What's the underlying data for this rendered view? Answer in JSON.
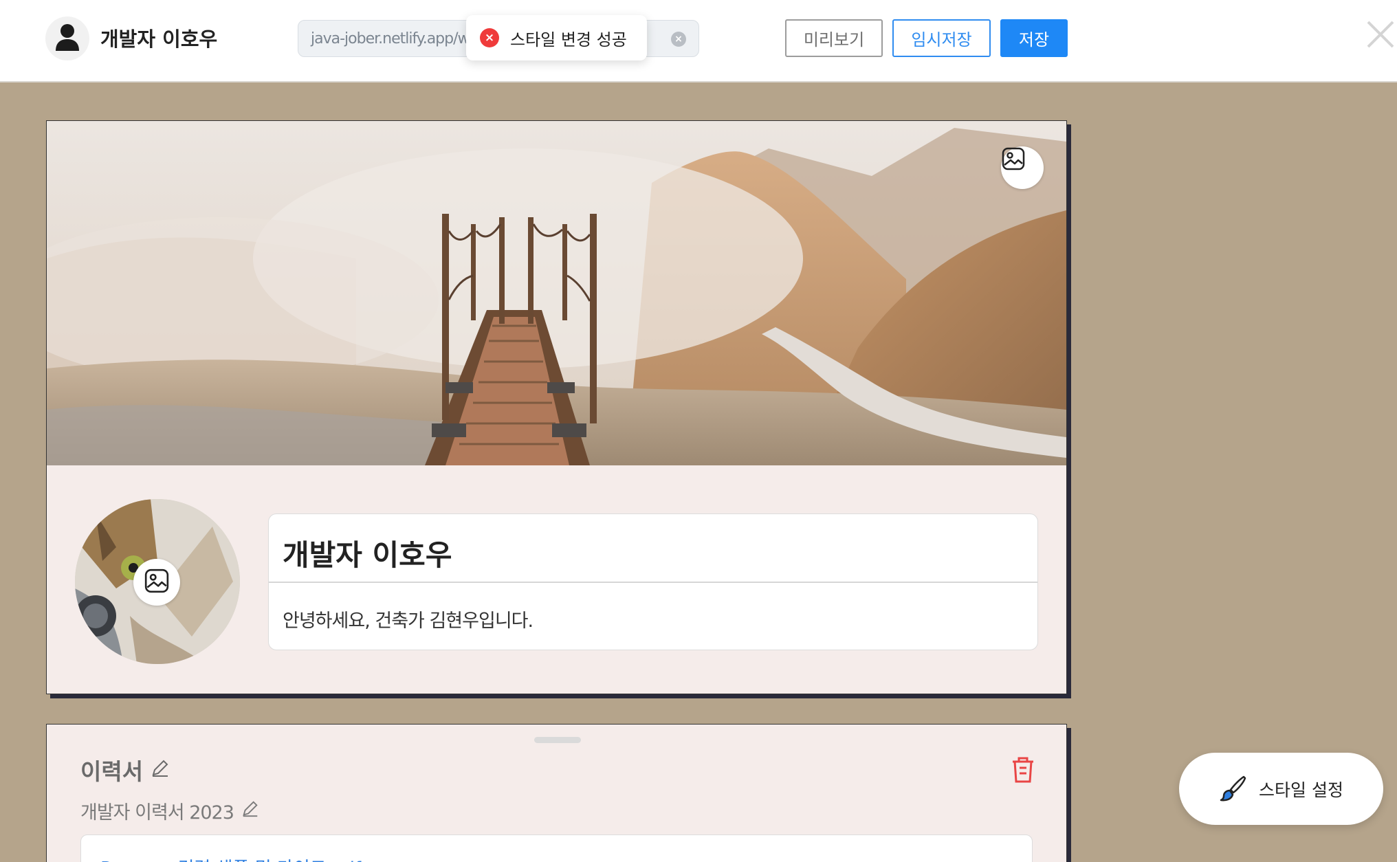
{
  "header": {
    "owner_name": "개발자 이호우",
    "url_text": "java-jober.netlify.app/wa",
    "toast_text": "스타일 변경 성공",
    "preview_label": "미리보기",
    "draft_label": "임시저장",
    "save_label": "저장"
  },
  "profile": {
    "name": "개발자 이호우",
    "bio": "안녕하세요, 건축가 김현우입니다."
  },
  "resume": {
    "title": "이력서",
    "subtitle": "개발자 이력서 2023",
    "file_name": "Resume 경력 샘플 및 가이드.pdf"
  },
  "style_button": {
    "label": "스타일 설정"
  },
  "colors": {
    "background": "#b5a48b",
    "card": "#f5ecea",
    "primary": "#1e88f6",
    "danger": "#ef3b3b"
  },
  "icons": [
    "user-icon",
    "close-icon",
    "image-icon",
    "pencil-icon",
    "trash-icon",
    "brush-icon",
    "error-icon",
    "clear-icon"
  ]
}
